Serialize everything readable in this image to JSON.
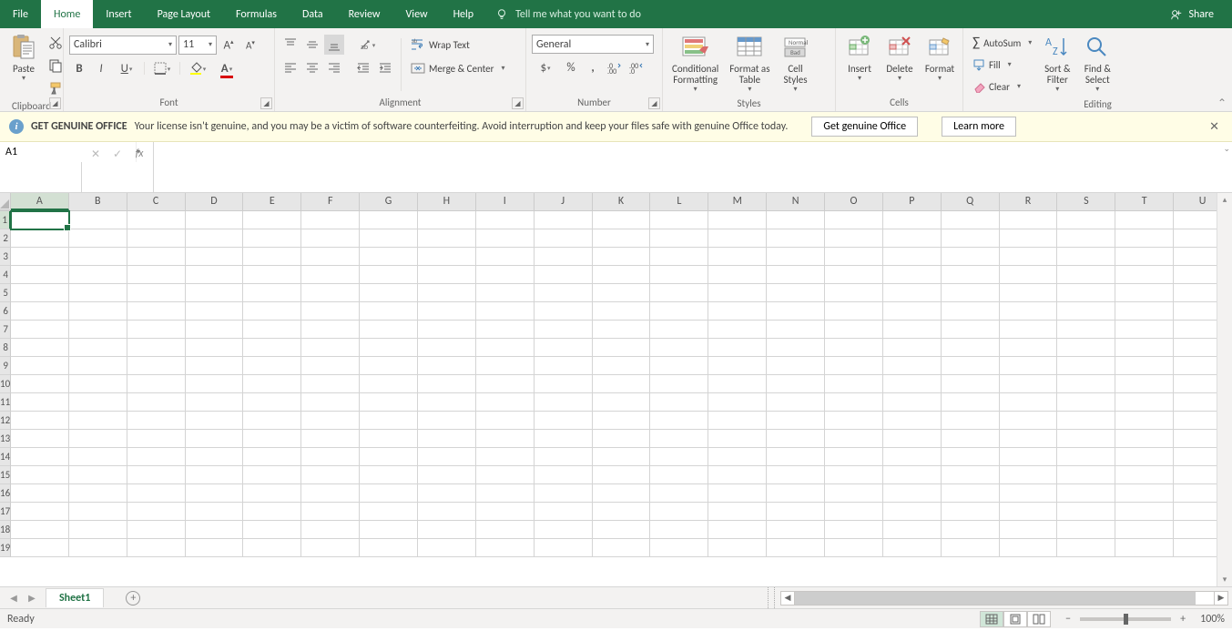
{
  "tabs": {
    "items": [
      "File",
      "Home",
      "Insert",
      "Page Layout",
      "Formulas",
      "Data",
      "Review",
      "View",
      "Help"
    ],
    "active": "Home",
    "tellme": "Tell me what you want to do",
    "share": "Share"
  },
  "ribbon": {
    "clipboard": {
      "label": "Clipboard",
      "paste": "Paste"
    },
    "font": {
      "label": "Font",
      "name": "Calibri",
      "size": "11"
    },
    "alignment": {
      "label": "Alignment",
      "wrap": "Wrap Text",
      "merge": "Merge & Center"
    },
    "number": {
      "label": "Number",
      "format": "General"
    },
    "styles": {
      "label": "Styles",
      "cond": "Conditional\nFormatting",
      "table": "Format as\nTable",
      "cell": "Cell\nStyles"
    },
    "cells": {
      "label": "Cells",
      "insert": "Insert",
      "delete": "Delete",
      "format": "Format"
    },
    "editing": {
      "label": "Editing",
      "autosum": "AutoSum",
      "fill": "Fill",
      "clear": "Clear",
      "sort": "Sort &\nFilter",
      "find": "Find &\nSelect"
    }
  },
  "notif": {
    "title": "GET GENUINE OFFICE",
    "msg": "Your license isn't genuine, and you may be a victim of software counterfeiting. Avoid interruption and keep your files safe with genuine Office today.",
    "btn1": "Get genuine Office",
    "btn2": "Learn more"
  },
  "fbar": {
    "name": "A1",
    "formula": ""
  },
  "columns": [
    "A",
    "B",
    "C",
    "D",
    "E",
    "F",
    "G",
    "H",
    "I",
    "J",
    "K",
    "L",
    "M",
    "N",
    "O",
    "P",
    "Q",
    "R",
    "S",
    "T",
    "U"
  ],
  "rows": 19,
  "active_cell": {
    "col": 0,
    "row": 0
  },
  "sheets": {
    "active": "Sheet1"
  },
  "status": {
    "ready": "Ready",
    "zoom": "100%"
  }
}
